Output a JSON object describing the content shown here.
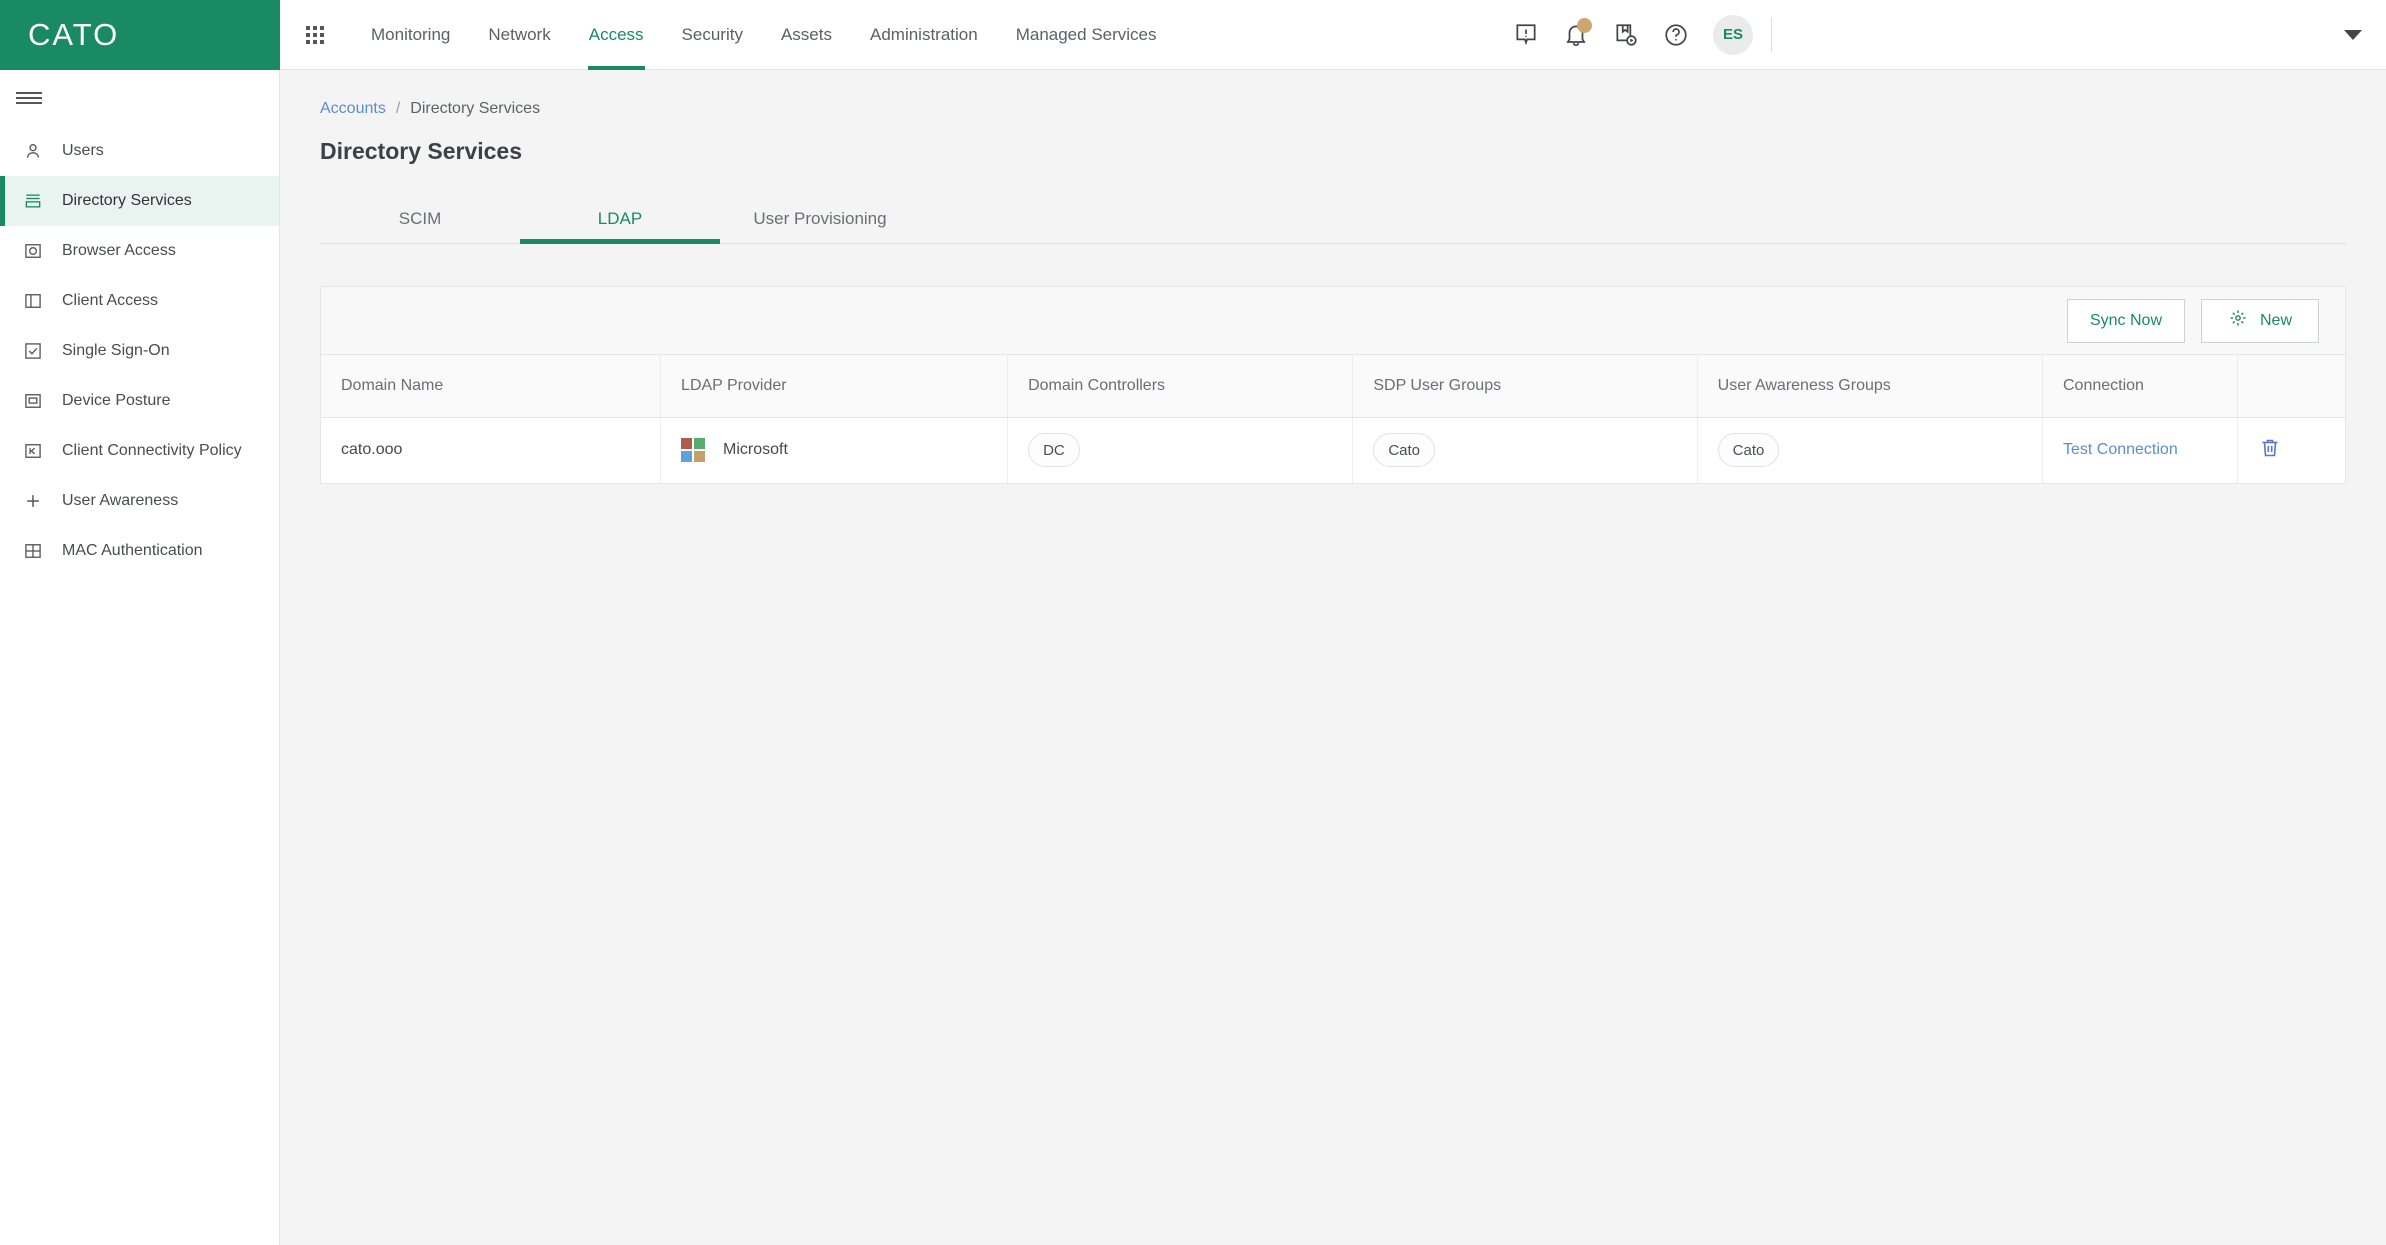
{
  "brand": {
    "name": "CATO"
  },
  "topnav": {
    "apps_icon": "apps-grid-icon",
    "items": [
      {
        "label": "Monitoring",
        "active": false
      },
      {
        "label": "Network",
        "active": false
      },
      {
        "label": "Access",
        "active": true
      },
      {
        "label": "Security",
        "active": false
      },
      {
        "label": "Assets",
        "active": false
      },
      {
        "label": "Administration",
        "active": false
      },
      {
        "label": "Managed Services",
        "active": false
      }
    ],
    "icons": [
      {
        "name": "alert-icon"
      },
      {
        "name": "notifications-bell-icon",
        "has_badge": true
      },
      {
        "name": "whats-new-icon"
      },
      {
        "name": "help-icon"
      }
    ],
    "avatar_initials": "ES",
    "account_caret": "chevron-down-icon"
  },
  "sidebar": {
    "items": [
      {
        "label": "Users",
        "icon": "user-icon",
        "active": false
      },
      {
        "label": "Directory Services",
        "icon": "directory-icon",
        "active": true
      },
      {
        "label": "Browser Access",
        "icon": "browser-icon",
        "active": false
      },
      {
        "label": "Client Access",
        "icon": "panel-icon",
        "active": false
      },
      {
        "label": "Single Sign-On",
        "icon": "checkbox-icon",
        "active": false
      },
      {
        "label": "Device Posture",
        "icon": "monitor-icon",
        "active": false
      },
      {
        "label": "Client Connectivity Policy",
        "icon": "connectivity-icon",
        "active": false
      },
      {
        "label": "User Awareness",
        "icon": "plus-icon",
        "active": false
      },
      {
        "label": "MAC Authentication",
        "icon": "grid-icon",
        "active": false
      }
    ]
  },
  "breadcrumb": {
    "root": "Accounts",
    "separator": "/",
    "current": "Directory Services"
  },
  "page": {
    "title": "Directory Services"
  },
  "tabs": [
    {
      "label": "SCIM",
      "active": false
    },
    {
      "label": "LDAP",
      "active": true
    },
    {
      "label": "User Provisioning",
      "active": false
    }
  ],
  "toolbar": {
    "sync_label": "Sync Now",
    "new_label": "New",
    "new_icon": "sparkle-icon"
  },
  "table": {
    "columns": [
      "Domain Name",
      "LDAP Provider",
      "Domain Controllers",
      "SDP User Groups",
      "User Awareness Groups",
      "Connection"
    ],
    "rows": [
      {
        "domain_name": "cato.ooo",
        "provider_logo": "microsoft-logo",
        "provider": "Microsoft",
        "domain_controllers": "DC",
        "sdp_user_groups": "Cato",
        "user_awareness_groups": "Cato",
        "connection": "Test Connection",
        "delete_icon": "trash-icon"
      }
    ]
  },
  "colors": {
    "brand_green": "#1a8a64",
    "link_blue": "#5b8ed0",
    "badge_tan": "#cfa66f",
    "ms_red": "#b05c4a",
    "ms_green": "#5aab6e",
    "ms_blue": "#5ba3dd",
    "ms_yellow": "#c4a06a"
  }
}
